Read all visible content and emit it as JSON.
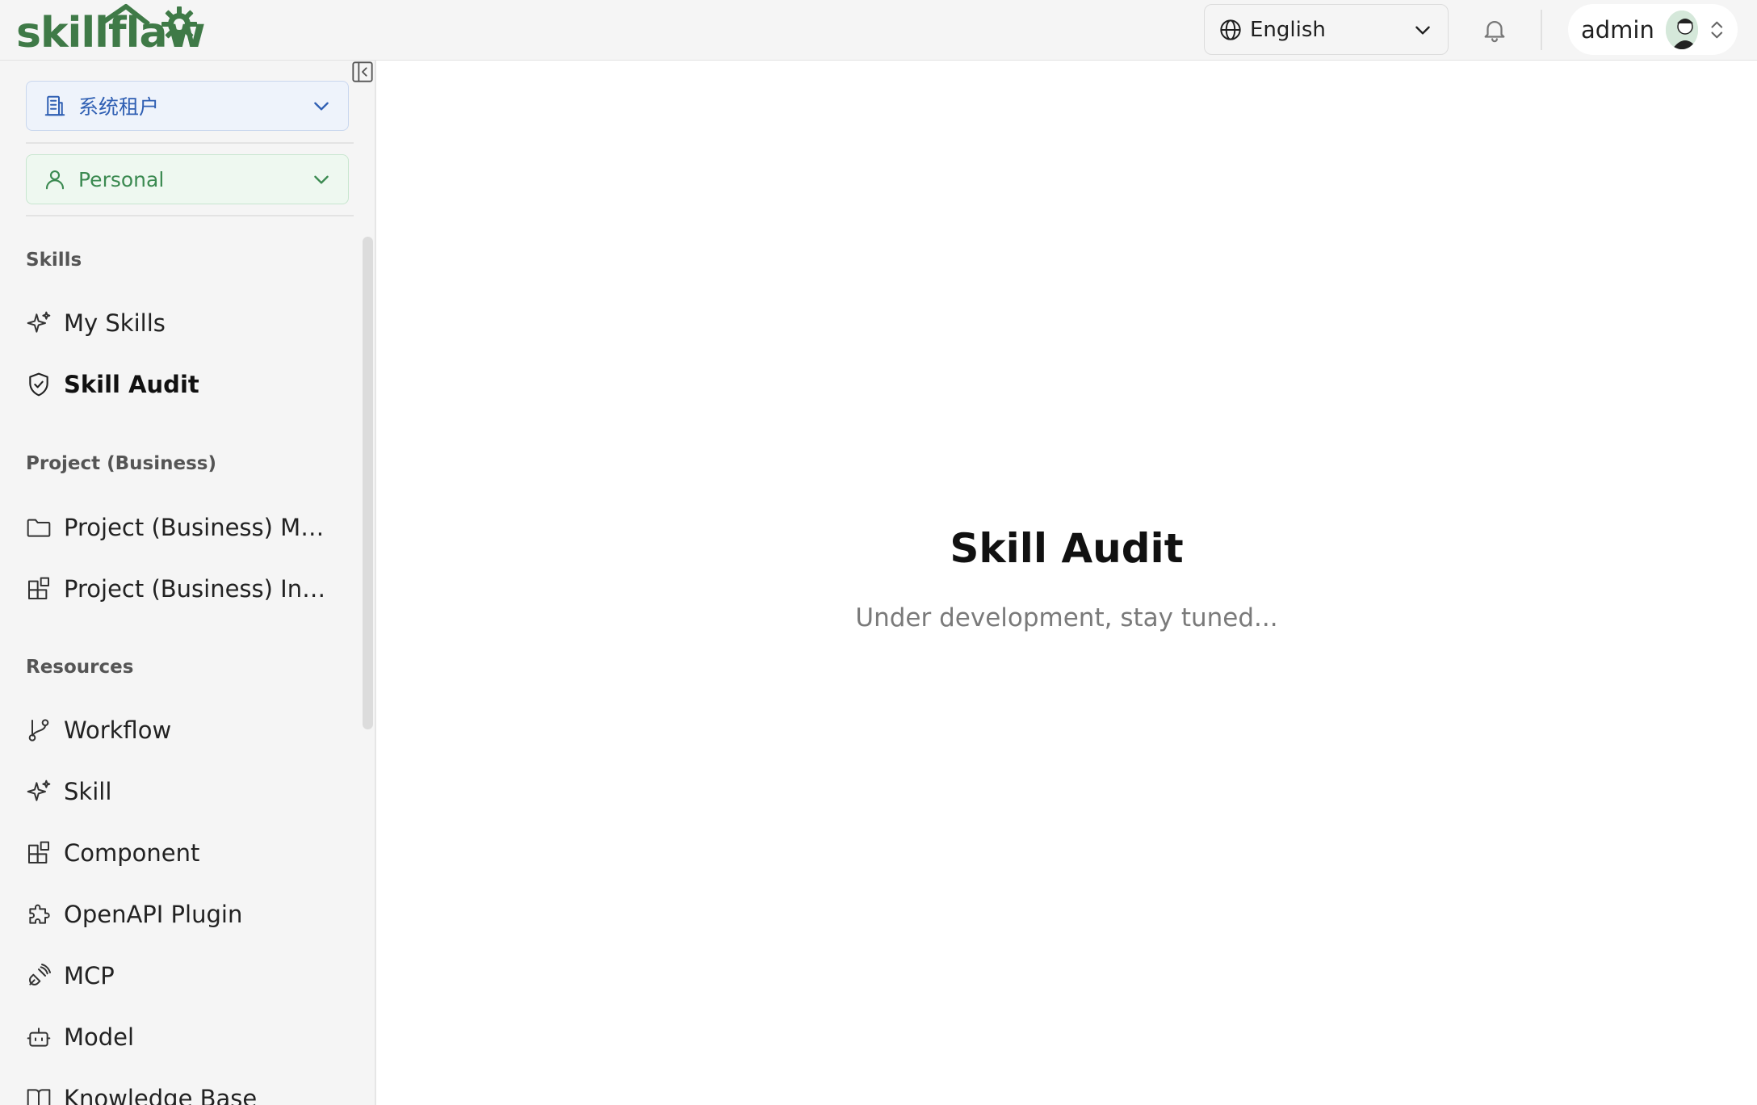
{
  "header": {
    "logo_text": "skillflaw",
    "language": {
      "label": "English"
    },
    "user": {
      "name": "admin"
    }
  },
  "sidebar": {
    "tenant_select": {
      "label": "系统租户"
    },
    "scope_select": {
      "label": "Personal"
    },
    "sections": [
      {
        "title": "Skills",
        "items": [
          {
            "label": "My Skills",
            "icon": "sparkle-icon"
          },
          {
            "label": "Skill Audit",
            "icon": "shield-check-icon",
            "active": true
          }
        ]
      },
      {
        "title": "Project (Business)",
        "items": [
          {
            "label": "Project (Business) Management",
            "icon": "folder-icon"
          },
          {
            "label": "Project (Business) Integration",
            "icon": "blocks-icon"
          }
        ]
      },
      {
        "title": "Resources",
        "items": [
          {
            "label": "Workflow",
            "icon": "git-branch-icon"
          },
          {
            "label": "Skill",
            "icon": "sparkle-icon"
          },
          {
            "label": "Component",
            "icon": "blocks-icon"
          },
          {
            "label": "OpenAPI Plugin",
            "icon": "puzzle-icon"
          },
          {
            "label": "MCP",
            "icon": "plug-icon"
          },
          {
            "label": "Model",
            "icon": "bot-icon"
          },
          {
            "label": "Knowledge Base",
            "icon": "book-icon"
          }
        ]
      }
    ]
  },
  "main": {
    "title": "Skill Audit",
    "subtitle": "Under development, stay tuned..."
  },
  "colors": {
    "brand_green": "#3f7a47",
    "tenant_blue": "#2f5fb3",
    "personal_green": "#3b8a51"
  }
}
